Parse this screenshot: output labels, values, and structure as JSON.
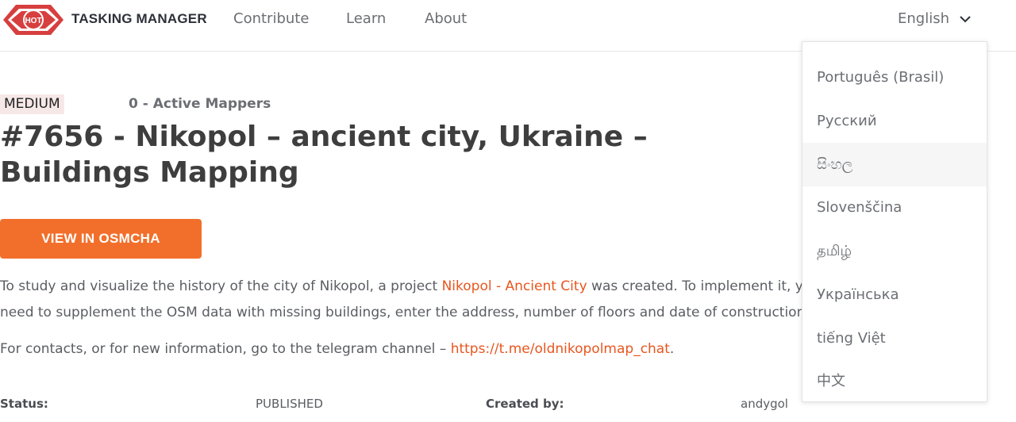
{
  "header": {
    "brand": "TASKING MANAGER",
    "logo_text": "HOT",
    "nav": {
      "contribute": "Contribute",
      "learn": "Learn",
      "about": "About"
    },
    "language": "English",
    "chevron_icon": "chevron-down-icon"
  },
  "language_menu": {
    "items": [
      "Português (Brasil)",
      "Русский",
      "සිංහල",
      "Slovenščina",
      "தமிழ்",
      "Українська",
      "tiếng Việt",
      "中文"
    ]
  },
  "project": {
    "difficulty": "MEDIUM",
    "active_mappers": "0 - Active Mappers",
    "title": "#7656 - Nikopol – ancient city, Ukraine – Buildings Mapping",
    "osmcha_button": "VIEW IN OSMCHA",
    "description": {
      "part1": "To study and visualize the history of the city of Nikopol, a project ",
      "link": "Nikopol - Ancient City",
      "part2": " was created. To implement it, yo",
      "line2": "need to supplement the OSM data with missing buildings, enter the address, number of floors and date of construction"
    },
    "contacts": {
      "text": "For contacts, or for new information, go to the telegram channel – ",
      "link": "https://t.me/oldnikopolmap_chat",
      "end": "."
    },
    "meta": {
      "status_label": "Status:",
      "status_value": "PUBLISHED",
      "created_label": "Created by:",
      "created_value": "andygol"
    }
  },
  "colors": {
    "accent": "#f26f2b",
    "logo_red": "#d73f3f",
    "badge_bg": "#f7e8e8"
  }
}
